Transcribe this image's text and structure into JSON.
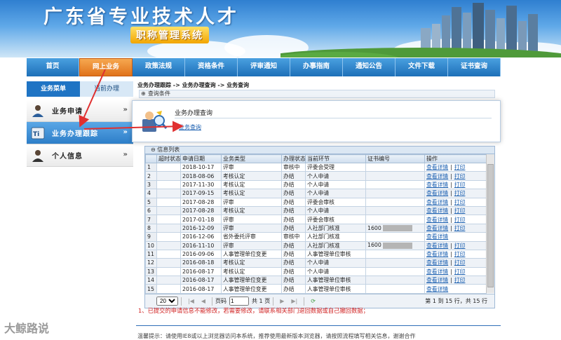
{
  "header": {
    "title": "广东省专业技术人才",
    "subtitle": "职称管理系统"
  },
  "nav": {
    "items": [
      {
        "label": "首页"
      },
      {
        "label": "网上业务"
      },
      {
        "label": "政策法规"
      },
      {
        "label": "资格条件"
      },
      {
        "label": "评审通知"
      },
      {
        "label": "办事指南"
      },
      {
        "label": "通知公告"
      },
      {
        "label": "文件下载"
      },
      {
        "label": "证书查询"
      }
    ],
    "active_index": 1
  },
  "sidebar": {
    "tabs": [
      {
        "label": "业务菜单"
      },
      {
        "label": "当前办理"
      }
    ],
    "items": [
      {
        "label": "业务申请",
        "icon": "person-apply-icon"
      },
      {
        "label": "业务办理跟踪",
        "icon": "track-icon"
      },
      {
        "label": "个人信息",
        "icon": "person-icon"
      }
    ],
    "chevron": "»"
  },
  "main": {
    "breadcrumb": "业务办理跟踪 -> 业务办理查询 -> 业务查询",
    "condition_label": "查询条件",
    "popup": {
      "title": "业务办理查询",
      "link": "业务查询"
    },
    "grid": {
      "caption": "信息列表",
      "columns": [
        "",
        "超时状态",
        "申请日期",
        "业务类型",
        "办理状态",
        "当前环节",
        "证书编号",
        "操作"
      ],
      "rows": [
        {
          "n": "1",
          "date": "2018-10-17",
          "type": "评审",
          "status": "审核中",
          "step": "评委会受理",
          "cert": "",
          "blur": false,
          "actions": [
            "查看详情",
            "打印"
          ]
        },
        {
          "n": "2",
          "date": "2018-08-06",
          "type": "考核认定",
          "status": "办结",
          "step": "个人申请",
          "cert": "",
          "blur": false,
          "actions": [
            "查看详情",
            "打印"
          ]
        },
        {
          "n": "3",
          "date": "2017-11-30",
          "type": "考核认定",
          "status": "办结",
          "step": "个人申请",
          "cert": "",
          "blur": false,
          "actions": [
            "查看详情",
            "打印"
          ]
        },
        {
          "n": "4",
          "date": "2017-09-15",
          "type": "考核认定",
          "status": "办结",
          "step": "个人申请",
          "cert": "",
          "blur": false,
          "actions": [
            "查看详情",
            "打印"
          ]
        },
        {
          "n": "5",
          "date": "2017-08-28",
          "type": "评审",
          "status": "办结",
          "step": "评委会审核",
          "cert": "",
          "blur": false,
          "actions": [
            "查看详情",
            "打印"
          ]
        },
        {
          "n": "6",
          "date": "2017-08-28",
          "type": "考核认定",
          "status": "办结",
          "step": "个人申请",
          "cert": "",
          "blur": false,
          "actions": [
            "查看详情",
            "打印"
          ]
        },
        {
          "n": "7",
          "date": "2017-01-18",
          "type": "评审",
          "status": "办结",
          "step": "评委会审核",
          "cert": "",
          "blur": false,
          "actions": [
            "查看详情",
            "打印"
          ]
        },
        {
          "n": "8",
          "date": "2016-12-09",
          "type": "评审",
          "status": "办结",
          "step": "人社部门核准",
          "cert": "1600",
          "blur": true,
          "actions": [
            "查看详情",
            "打印"
          ]
        },
        {
          "n": "9",
          "date": "2016-12-06",
          "type": "省外委托评审",
          "status": "审核中",
          "step": "人社部门核准",
          "cert": "",
          "blur": false,
          "actions": [
            "查看详情"
          ]
        },
        {
          "n": "10",
          "date": "2016-11-10",
          "type": "评审",
          "status": "办结",
          "step": "人社部门核准",
          "cert": "1600",
          "blur": true,
          "actions": [
            "查看详情",
            "打印"
          ]
        },
        {
          "n": "11",
          "date": "2016-09-06",
          "type": "人事管理单位变更",
          "status": "办结",
          "step": "人事管理单位审核",
          "cert": "",
          "blur": false,
          "actions": [
            "查看详情",
            "打印"
          ]
        },
        {
          "n": "12",
          "date": "2016-08-18",
          "type": "考核认定",
          "status": "办结",
          "step": "个人申请",
          "cert": "",
          "blur": false,
          "actions": [
            "查看详情",
            "打印"
          ]
        },
        {
          "n": "13",
          "date": "2016-08-17",
          "type": "考核认定",
          "status": "办结",
          "step": "个人申请",
          "cert": "",
          "blur": false,
          "actions": [
            "查看详情",
            "打印"
          ]
        },
        {
          "n": "14",
          "date": "2016-08-17",
          "type": "人事管理单位变更",
          "status": "办结",
          "step": "人事管理单位审核",
          "cert": "",
          "blur": false,
          "actions": [
            "查看详情",
            "打印"
          ]
        },
        {
          "n": "15",
          "date": "2016-08-17",
          "type": "人事管理单位变更",
          "status": "办结",
          "step": "人事管理单位审核",
          "cert": "",
          "blur": false,
          "actions": [
            "查看详情"
          ]
        }
      ]
    },
    "pager": {
      "page_size": "20",
      "page_label": "页码",
      "page_value": "1",
      "total_pages": "共 1 页",
      "summary": "第 1 到 15 行，共 15 行"
    },
    "note": "1、已提交的申请信息不能修改，若需要修改，请联系相关部门退回数据或自己撤回数据；",
    "footer": "温馨提示：请使用IE8或以上浏览器访问本系统，推荐使用最新版本浏览器，请按照流程填写相关信息，谢谢合作"
  },
  "watermark": "大鲸路说",
  "colors": {
    "nav_blue": "#1d6fb8",
    "nav_active_orange": "#e0721a",
    "arrow_red": "#e03030",
    "link_blue": "#1a5fb0",
    "note_red": "#d02020"
  }
}
